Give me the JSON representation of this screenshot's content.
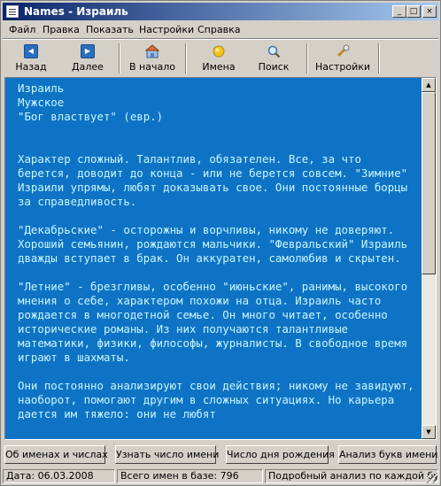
{
  "window": {
    "title": "Names - Израиль"
  },
  "title_buttons": {
    "minimize": "_",
    "maximize": "□",
    "close": "×"
  },
  "menu": [
    "Файл",
    "Правка",
    "Показать",
    "Настройки",
    "Справка"
  ],
  "toolbar": [
    {
      "label": "Назад",
      "icon": "back-arrow-icon"
    },
    {
      "label": "Далее",
      "icon": "forward-arrow-icon"
    },
    {
      "label": "В начало",
      "icon": "home-icon"
    },
    {
      "label": "Имена",
      "icon": "names-icon"
    },
    {
      "label": "Поиск",
      "icon": "search-icon"
    },
    {
      "label": "Настройки",
      "icon": "settings-icon"
    }
  ],
  "content": {
    "name": "Израиль",
    "gender": "Мужское",
    "meaning": "\"Бог властвует\" (евр.)",
    "paragraphs": [
      "Характер сложный. Талантлив, обязателен. Все, за что берется, доводит до конца - или не берется совсем. \"Зимние\" Израили упрямы, любят доказывать свое. Они постоянные борцы за справедливость.",
      "\"Декабрьские\" - осторожны и ворчливы, никому не доверяют. Хороший семьянин, рождаются мальчики. \"Февральский\" Израиль дважды вступает в брак. Он аккуратен, самолюбив и скрытен.",
      "\"Летние\" - брезгливы, особенно \"июньские\", ранимы, высокого мнения о себе, характером похожи на отца. Израиль часто рождается в многодетной семье. Он много читает, особенно исторические романы. Из них получаются талантливые математики, физики, философы, журналисты. В свободное время играют в шахматы.",
      "Они постоянно анализируют свои действия; никому не завидуют, наоборот, помогают другим в сложных ситуациях. Но карьера дается им тяжело: они не любят"
    ]
  },
  "buttons": [
    "Об именах и числах",
    "Узнать число имени",
    "Число дня рождения",
    "Анализ букв имени"
  ],
  "status": {
    "date": "Дата: 06.03.2008",
    "total": "Всего имен в базе: 796",
    "analysis": "Подробный анализ по каждой букв"
  },
  "colors": {
    "content_bg": "#0e73c4",
    "content_text": "#c8f5ff",
    "title_start": "#0a246a",
    "title_end": "#a6caf0"
  }
}
